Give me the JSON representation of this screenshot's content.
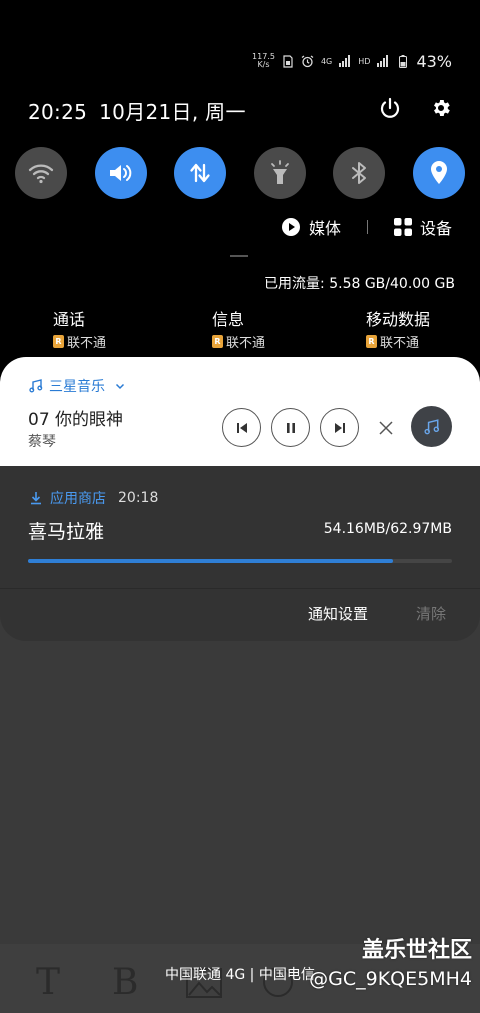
{
  "status_bar": {
    "speed_value": "117.5",
    "speed_unit": "K/s",
    "network_4g": "4G",
    "hd": "HD",
    "battery": "43%"
  },
  "header": {
    "time": "20:25",
    "date": "10月21日, 周一"
  },
  "quick_settings": [
    {
      "name": "wifi",
      "icon": "wifi-icon",
      "active": false
    },
    {
      "name": "sound",
      "icon": "volume-icon",
      "active": true
    },
    {
      "name": "mobile-data",
      "icon": "data-arrows-icon",
      "active": true
    },
    {
      "name": "flashlight",
      "icon": "flashlight-icon",
      "active": false
    },
    {
      "name": "bluetooth",
      "icon": "bluetooth-icon",
      "active": false
    },
    {
      "name": "location",
      "icon": "location-icon",
      "active": true
    }
  ],
  "media_output": {
    "media_label": "媒体",
    "devices_label": "设备"
  },
  "data_usage": "已用流量: 5.58 GB/40.00 GB",
  "sim_badge": "R",
  "carriers": [
    {
      "title": "通话",
      "status": "联不通"
    },
    {
      "title": "信息",
      "status": "联不通"
    },
    {
      "title": "移动数据",
      "status": "联不通"
    }
  ],
  "music": {
    "app": "三星音乐",
    "title": "07 你的眼神",
    "artist": "蔡琴"
  },
  "download": {
    "app": "应用商店",
    "time": "20:18",
    "title": "喜马拉雅",
    "size": "54.16MB/62.97MB",
    "progress": 0.86
  },
  "notification_actions": {
    "settings": "通知设置",
    "clear": "清除"
  },
  "bottom": {
    "carrier_line": "中国联通 4G | 中国电信",
    "fmt_t": "T",
    "fmt_b": "B"
  },
  "watermark": {
    "brand": "盖乐世社区",
    "user": "@GC_9KQE5MH4"
  },
  "colors": {
    "accent": "#3d8ef0",
    "tile_off": "#4a4a4a",
    "progress": "#2f7fd6",
    "sim_badge": "#e8a43a"
  }
}
